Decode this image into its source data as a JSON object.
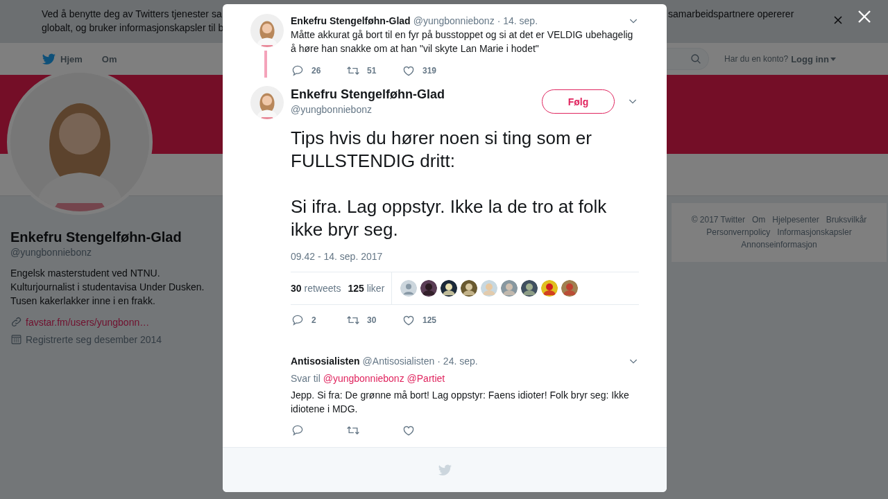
{
  "cookie_banner": {
    "lines_left": [
      "Ved å benytte deg av Twitters tjenester sa",
      "globalt, og bruker informasjonskapsler til b"
    ],
    "text_right": "samarbeidspartnere opererer"
  },
  "nav": {
    "items": [
      "Hjem",
      "Om"
    ],
    "account_prompt": "Har du en konto?",
    "login": "Logg inn"
  },
  "profile": {
    "name": "Enkefru Stengelføhn-Glad",
    "handle": "@yungbonniebonz",
    "bio": [
      "Engelsk masterstudent ved NTNU.",
      "Kulturjournalist i studentavisa Under Dusken.",
      "Tusen kakerlakker inne i en frakk."
    ],
    "link": "favstar.fm/users/yungbonn…",
    "joined": "Registrerte seg desember 2014"
  },
  "footer_links": [
    "© 2017 Twitter",
    "Om",
    "Hjelpesenter",
    "Bruksvilkår",
    "Personvernpolicy",
    "Informasjonskapsler",
    "Annonseinformasjon"
  ],
  "modal": {
    "parent_tweet": {
      "name": "Enkefru Stengelføhn-Glad",
      "handle": "@yungbonniebonz",
      "date": "· 14. sep.",
      "text": "Måtte akkurat gå bort til en fyr på busstoppet og si at det er VELDIG ubehagelig å høre han snakke om at han \"vil skyte Lan Marie i hodet\"",
      "replies": "26",
      "retweets": "51",
      "likes": "319"
    },
    "tweet": {
      "name": "Enkefru Stengelføhn-Glad",
      "handle": "@yungbonniebonz",
      "follow_label": "Følg",
      "paragraphs": [
        "Tips hvis du hører noen si ting som er FULLSTENDIG dritt:",
        "Si ifra. Lag oppstyr. Ikke la de tro at folk ikke bryr seg."
      ],
      "timestamp": "09.42 - 14. sep. 2017",
      "stats": [
        {
          "count": "30",
          "label": "retweets"
        },
        {
          "count": "125",
          "label": "liker"
        }
      ],
      "likers": [
        {
          "kind": "default"
        },
        {
          "kind": "picture"
        },
        {
          "kind": "picture"
        },
        {
          "kind": "picture"
        },
        {
          "kind": "picture"
        },
        {
          "kind": "picture"
        },
        {
          "kind": "picture"
        },
        {
          "kind": "picture"
        },
        {
          "kind": "picture"
        }
      ],
      "replies": "2",
      "retweets": "30",
      "likes": "125"
    },
    "replies": [
      {
        "name": "Antisosialisten",
        "handle": "@Antisosialisten",
        "date": "· 24. sep.",
        "reply_label": "Svar til",
        "mentions": [
          "@yungbonniebonz",
          "@Partiet"
        ],
        "text": "Jepp. Si fra: De grønne må bort! Lag oppstyr: Faens idioter! Folk bryr seg: Ikke idiotene i MDG."
      }
    ]
  }
}
